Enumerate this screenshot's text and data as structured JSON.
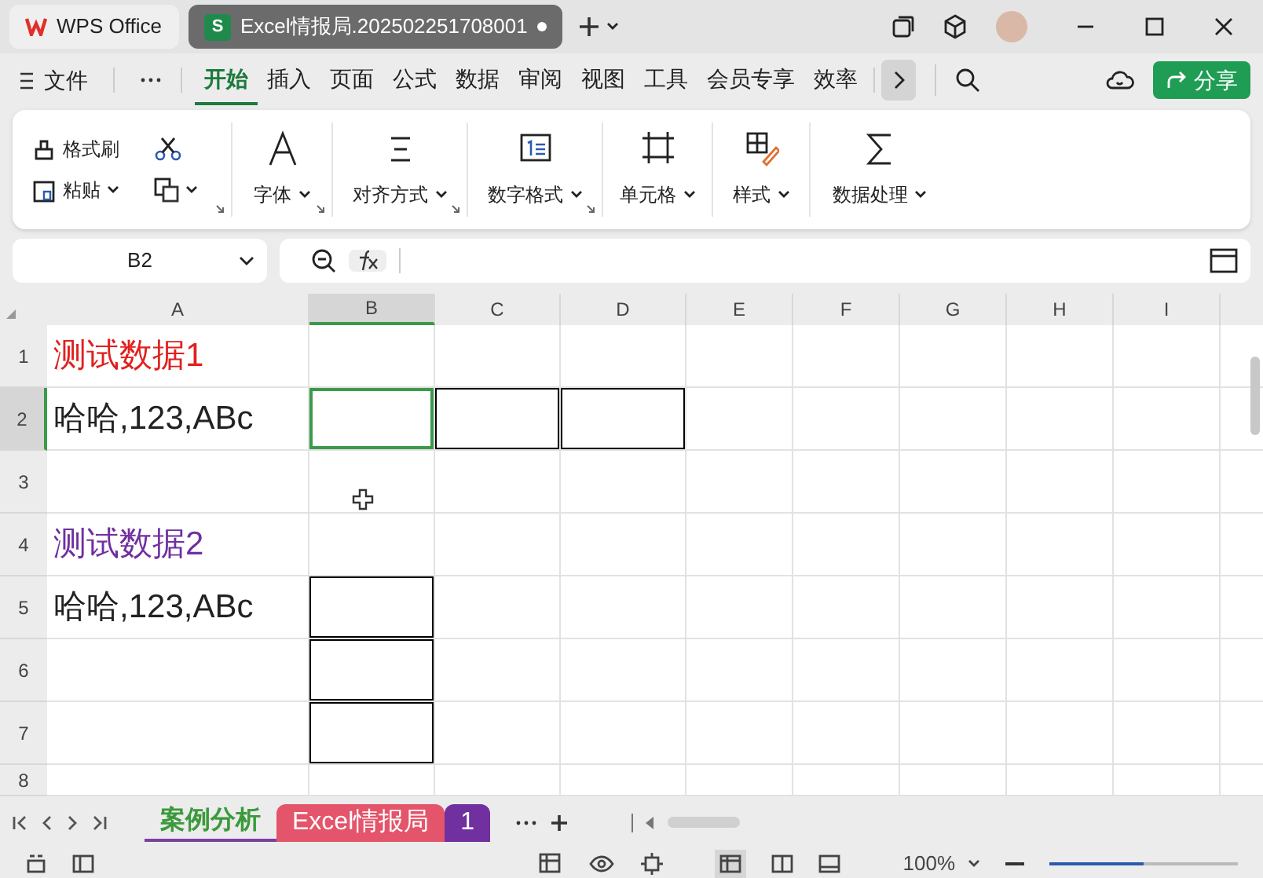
{
  "title_bar": {
    "tabs": [
      {
        "kind": "home",
        "label": "WPS Office",
        "selected": false
      },
      {
        "kind": "document",
        "icon_letter": "S",
        "label": "Excel情报局.202502251708001",
        "selected": true
      }
    ]
  },
  "menu": {
    "file_label": "文件",
    "items": [
      {
        "label": "开始",
        "selected": true
      },
      {
        "label": "插入",
        "selected": false
      },
      {
        "label": "页面",
        "selected": false
      },
      {
        "label": "公式",
        "selected": false
      },
      {
        "label": "数据",
        "selected": false
      },
      {
        "label": "审阅",
        "selected": false
      },
      {
        "label": "视图",
        "selected": false
      },
      {
        "label": "工具",
        "selected": false
      },
      {
        "label": "会员专享",
        "selected": false
      },
      {
        "label": "效率",
        "selected": false
      }
    ],
    "share_label": "分享"
  },
  "ribbon": {
    "clipboard": {
      "format_painter": "格式刷",
      "paste": "粘贴"
    },
    "groups": [
      {
        "kind": "font",
        "label": "字体"
      },
      {
        "kind": "align",
        "label": "对齐方式"
      },
      {
        "kind": "number",
        "label": "数字格式"
      },
      {
        "kind": "cell",
        "label": "单元格"
      },
      {
        "kind": "style",
        "label": "样式"
      },
      {
        "kind": "sum",
        "label": "数据处理"
      }
    ]
  },
  "name_box": "B2",
  "columns": [
    {
      "label": "A",
      "selected": false
    },
    {
      "label": "B",
      "selected": true
    },
    {
      "label": "C",
      "selected": false
    },
    {
      "label": "D",
      "selected": false
    },
    {
      "label": "E",
      "selected": false
    },
    {
      "label": "F",
      "selected": false
    },
    {
      "label": "G",
      "selected": false
    },
    {
      "label": "H",
      "selected": false
    },
    {
      "label": "I",
      "selected": false
    }
  ],
  "rows": [
    {
      "label": "1",
      "selected": false,
      "cells": [
        {
          "text": "测试数据1",
          "color": "#e0201e"
        }
      ]
    },
    {
      "label": "2",
      "selected": true,
      "cells": [
        {
          "text": "哈哈,123,ABc"
        },
        {
          "bordered": true,
          "selected": true
        },
        {
          "bordered": true
        },
        {
          "bordered": true
        }
      ]
    },
    {
      "label": "3",
      "selected": false,
      "cells": []
    },
    {
      "label": "4",
      "selected": false,
      "cells": [
        {
          "text": "测试数据2",
          "color": "#7030a0"
        }
      ]
    },
    {
      "label": "5",
      "selected": false,
      "cells": [
        {
          "text": "哈哈,123,ABc"
        },
        {
          "bordered": true
        }
      ]
    },
    {
      "label": "6",
      "selected": false,
      "cells": [
        {},
        {
          "bordered": true
        }
      ]
    },
    {
      "label": "7",
      "selected": false,
      "cells": [
        {},
        {
          "bordered": true
        }
      ]
    },
    {
      "label": "8",
      "selected": false,
      "cells": []
    }
  ],
  "sheet_tabs": [
    {
      "label": "案例分析",
      "selected": true,
      "color": "#3b9a3b"
    },
    {
      "label": "Excel情报局",
      "selected": false,
      "color": "#e4546a"
    },
    {
      "label": "1",
      "selected": false,
      "color": "#7030a0"
    }
  ],
  "status_bar": {
    "zoom": "100%",
    "zoom_slider": {
      "level": 0.5
    }
  }
}
